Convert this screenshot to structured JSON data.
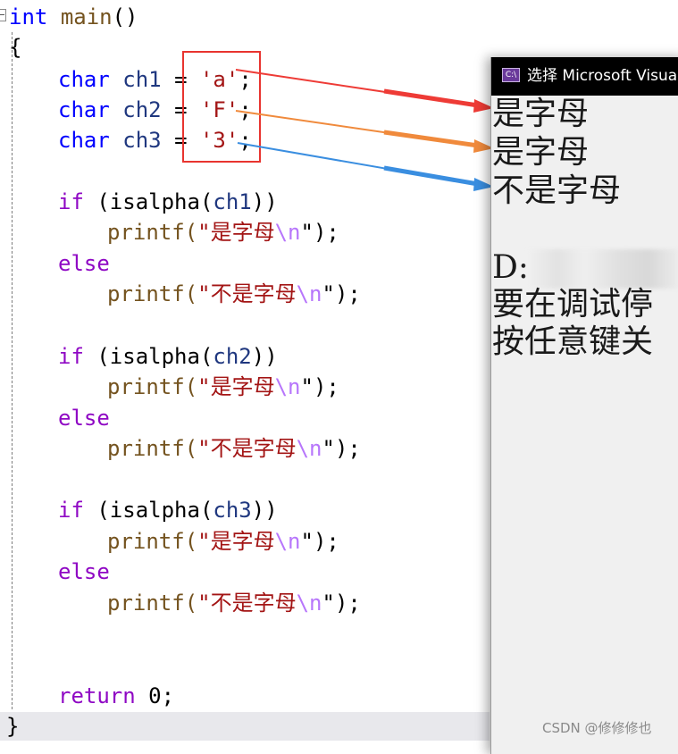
{
  "editor": {
    "signature": [
      "int",
      "main",
      "()"
    ],
    "open_brace": "{",
    "close_brace": "}",
    "declarations": [
      {
        "type": "char",
        "name": "ch1",
        "op": "=",
        "literal": "'a'",
        "semi": ";"
      },
      {
        "type": "char",
        "name": "ch2",
        "op": "=",
        "literal": "'F'",
        "semi": ";"
      },
      {
        "type": "char",
        "name": "ch3",
        "op": "=",
        "literal": "'3'",
        "semi": ";"
      }
    ],
    "blocks": [
      {
        "if_kw": "if",
        "call": "(isalpha(",
        "var": "ch1",
        "close": "))",
        "printf_a": "printf(",
        "str_a": "\"是字母",
        "esc": "\\n",
        "end_a": "\");",
        "else_kw": "else",
        "printf_b": "printf(",
        "str_b": "\"不是字母",
        "end_b": "\");"
      },
      {
        "if_kw": "if",
        "call": "(isalpha(",
        "var": "ch2",
        "close": "))",
        "printf_a": "printf(",
        "str_a": "\"是字母",
        "esc": "\\n",
        "end_a": "\");",
        "else_kw": "else",
        "printf_b": "printf(",
        "str_b": "\"不是字母",
        "end_b": "\");"
      },
      {
        "if_kw": "if",
        "call": "(isalpha(",
        "var": "ch3",
        "close": "))",
        "printf_a": "printf(",
        "str_a": "\"是字母",
        "esc": "\\n",
        "end_a": "\");",
        "else_kw": "else",
        "printf_b": "printf(",
        "str_b": "\"不是字母",
        "end_b": "\");"
      }
    ],
    "return_kw": "return",
    "return_val": "0;"
  },
  "console": {
    "title": "选择 Microsoft Visua",
    "icon_label": "C:\\",
    "output": [
      "是字母",
      "是字母",
      "不是字母"
    ],
    "path_prefix": "D:",
    "msg1": "要在调试停",
    "msg2": "按任意键关"
  },
  "arrow_colors": [
    "#ee3b36",
    "#f08a3c",
    "#3a8ee0"
  ],
  "highlight_color": "#e8342f",
  "watermark": "CSDN @修修修也"
}
